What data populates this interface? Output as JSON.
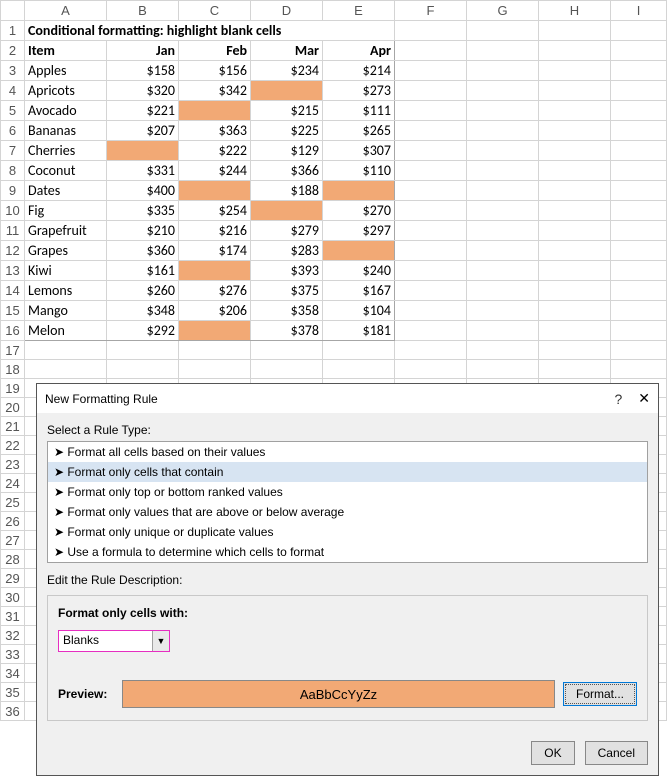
{
  "title": "Conditional formatting: highlight blank cells",
  "columns": [
    "A",
    "B",
    "C",
    "D",
    "E",
    "F",
    "G",
    "H",
    "I"
  ],
  "row_numbers": [
    1,
    2,
    3,
    4,
    5,
    6,
    7,
    8,
    9,
    10,
    11,
    12,
    13,
    14,
    15,
    16,
    17,
    18,
    19,
    20,
    21,
    22,
    23,
    24,
    25,
    26,
    27,
    28,
    29,
    30,
    31,
    32,
    33,
    34,
    35,
    36
  ],
  "headers": {
    "item": "Item",
    "jan": "Jan",
    "feb": "Feb",
    "mar": "Mar",
    "apr": "Apr"
  },
  "items": [
    {
      "name": "Apples",
      "vals": [
        "$158",
        "$156",
        "$234",
        "$214"
      ],
      "blank": []
    },
    {
      "name": "Apricots",
      "vals": [
        "$320",
        "$342",
        "",
        "$273"
      ],
      "blank": [
        2
      ]
    },
    {
      "name": "Avocado",
      "vals": [
        "$221",
        "",
        "$215",
        "$111"
      ],
      "blank": [
        1
      ]
    },
    {
      "name": "Bananas",
      "vals": [
        "$207",
        "$363",
        "$225",
        "$265"
      ],
      "blank": []
    },
    {
      "name": "Cherries",
      "vals": [
        "",
        "$222",
        "$129",
        "$307"
      ],
      "blank": [
        0
      ]
    },
    {
      "name": "Coconut",
      "vals": [
        "$331",
        "$244",
        "$366",
        "$110"
      ],
      "blank": []
    },
    {
      "name": "Dates",
      "vals": [
        "$400",
        "",
        "$188",
        ""
      ],
      "blank": [
        1,
        3
      ]
    },
    {
      "name": "Fig",
      "vals": [
        "$335",
        "$254",
        "",
        "$270"
      ],
      "blank": [
        2
      ]
    },
    {
      "name": "Grapefruit",
      "vals": [
        "$210",
        "$216",
        "$279",
        "$297"
      ],
      "blank": []
    },
    {
      "name": "Grapes",
      "vals": [
        "$360",
        "$174",
        "$283",
        ""
      ],
      "blank": [
        3
      ]
    },
    {
      "name": "Kiwi",
      "vals": [
        "$161",
        "",
        "$393",
        "$240"
      ],
      "blank": [
        1
      ]
    },
    {
      "name": "Lemons",
      "vals": [
        "$260",
        "$276",
        "$375",
        "$167"
      ],
      "blank": []
    },
    {
      "name": "Mango",
      "vals": [
        "$348",
        "$206",
        "$358",
        "$104"
      ],
      "blank": []
    },
    {
      "name": "Melon",
      "vals": [
        "$292",
        "",
        "$378",
        "$181"
      ],
      "blank": [
        1
      ]
    }
  ],
  "dialog": {
    "title": "New Formatting Rule",
    "select_label": "Select a Rule Type:",
    "rules": [
      "Format all cells based on their values",
      "Format only cells that contain",
      "Format only top or bottom ranked values",
      "Format only values that are above or below average",
      "Format only unique or duplicate values",
      "Use a formula to determine which cells to format"
    ],
    "selected_rule_index": 1,
    "edit_label": "Edit the Rule Description:",
    "group_title": "Format only cells with:",
    "combo_value": "Blanks",
    "preview_label": "Preview:",
    "preview_sample": "AaBbCcYyZz",
    "format_btn": "Format...",
    "ok": "OK",
    "cancel": "Cancel"
  }
}
